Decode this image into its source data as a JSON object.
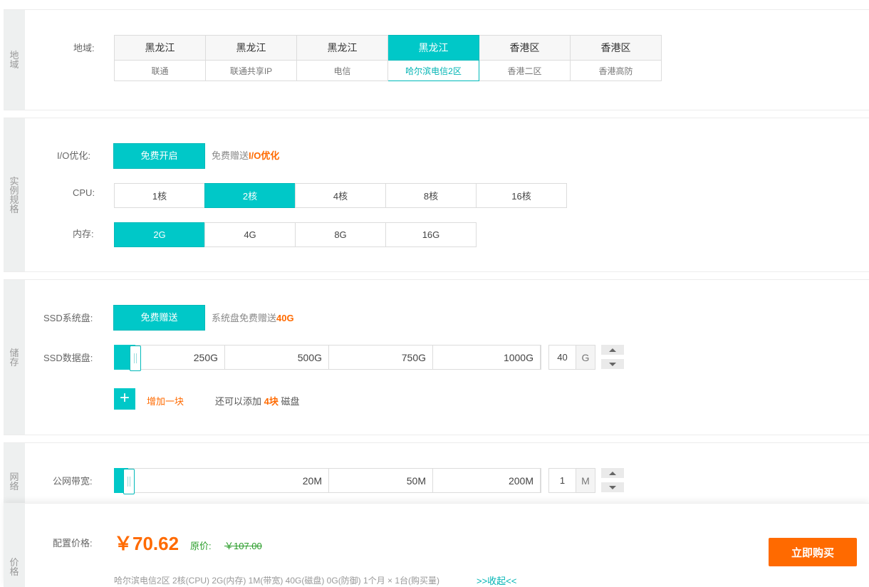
{
  "region": {
    "side_label": "地域",
    "label": "地域:",
    "options": [
      {
        "province": "黑龙江",
        "line": "联通"
      },
      {
        "province": "黑龙江",
        "line": "联通共享IP"
      },
      {
        "province": "黑龙江",
        "line": "电信"
      },
      {
        "province": "黑龙江",
        "line": "哈尔滨电信2区"
      },
      {
        "province": "香港区",
        "line": "香港二区"
      },
      {
        "province": "香港区",
        "line": "香港高防"
      }
    ],
    "selected_index": 3
  },
  "instance": {
    "side_label": "实例规格",
    "io_label": "I/O优化:",
    "io_button": "免费开启",
    "io_note_prefix": "免费赠送",
    "io_note_highlight": "I/O优化",
    "cpu_label": "CPU:",
    "cpu_options": [
      "1核",
      "2核",
      "4核",
      "8核",
      "16核"
    ],
    "cpu_selected": 1,
    "mem_label": "内存:",
    "mem_options": [
      "2G",
      "4G",
      "8G",
      "16G"
    ],
    "mem_selected": 0
  },
  "storage": {
    "side_label": "储存",
    "sys_label": "SSD系统盘:",
    "sys_button": "免费赠送",
    "sys_note_prefix": "系统盘免费赠送",
    "sys_note_highlight": "40G",
    "data_label": "SSD数据盘:",
    "data_marks": [
      "250G",
      "500G",
      "750G",
      "1000G"
    ],
    "data_value": "40",
    "data_unit": "G",
    "add_label": "增加一块",
    "remain_prefix": "还可以添加",
    "remain_count": "4块",
    "remain_suffix": "磁盘"
  },
  "network": {
    "side_label": "网络",
    "bw_label": "公网带宽:",
    "bw_marks": [
      "20M",
      "50M",
      "200M"
    ],
    "bw_value": "1",
    "bw_unit": "M"
  },
  "price": {
    "side_label": "价格",
    "label": "配置价格:",
    "current": "￥70.62",
    "orig_label": "原价:",
    "orig": "￥107.00",
    "buy_button": "立即购买",
    "summary": "哈尔滨电信2区   2核(CPU)   2G(内存)   1M(带宽)   40G(磁盘)   0G(防御)   1个月 × 1台(购买量)",
    "collapse": ">>收起<<"
  },
  "colors": {
    "accent": "#00c8c8",
    "price": "#ff6a00",
    "buy": "#ff6a00"
  }
}
